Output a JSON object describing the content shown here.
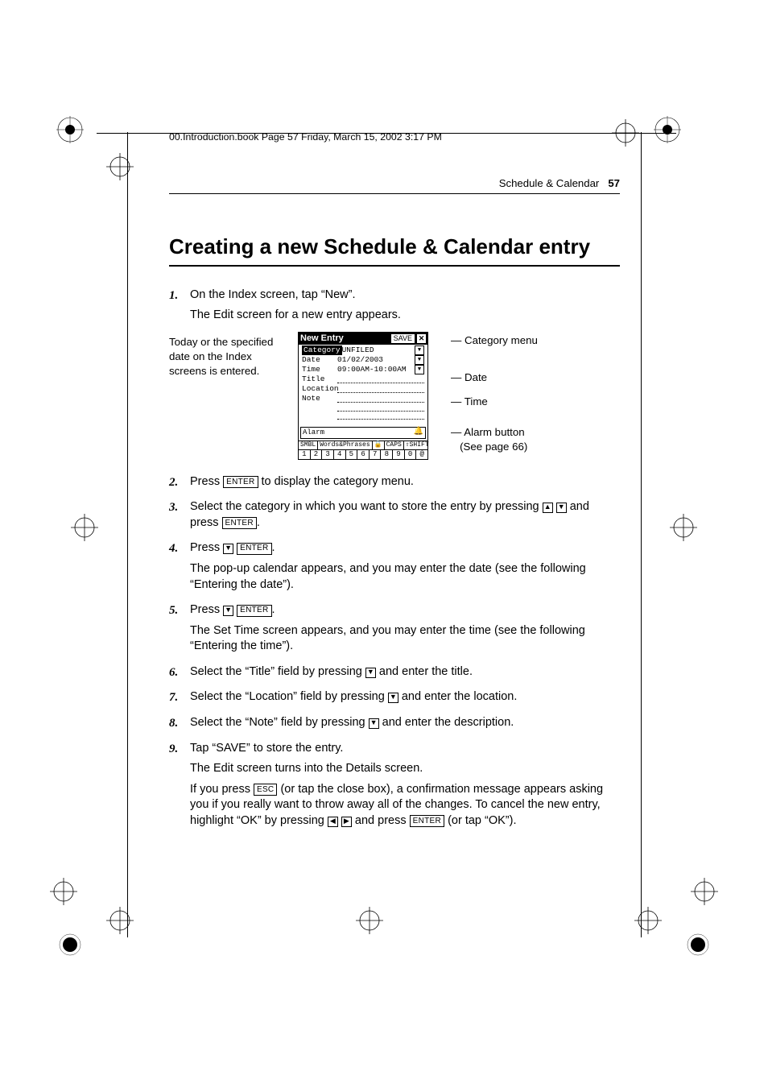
{
  "file_header": "00.Introduction.book  Page 57  Friday, March 15, 2002  3:17 PM",
  "running_head": {
    "section": "Schedule & Calendar",
    "page": "57"
  },
  "title": "Creating a new Schedule & Calendar entry",
  "sidecap_left": "Today or the specified date on the Index screens is entered.",
  "device": {
    "title": "New Entry",
    "save": "SAVE",
    "close": "✕",
    "rows": {
      "category_label": "Category",
      "category_value": "UNFILED",
      "date_label": "Date",
      "date_value": "01/02/2003",
      "time_label": "Time",
      "time_value": "09:00AM-10:00AM",
      "title_label": "Title",
      "location_label": "Location",
      "note_label": "Note",
      "alarm_label": "Alarm"
    },
    "softkeys": {
      "smbl": "SMBL",
      "words": "Words&Phrases",
      "lock": "🔒",
      "caps": "CAPS",
      "shift": "⇧SHIFT"
    },
    "numrow": [
      "1",
      "2",
      "3",
      "4",
      "5",
      "6",
      "7",
      "8",
      "9",
      "0",
      "@"
    ]
  },
  "callouts": {
    "category": "Category menu",
    "date": "Date",
    "time": "Time",
    "alarm1": "Alarm button",
    "alarm2": "(See page 66)"
  },
  "keys": {
    "enter": "ENTER",
    "esc": "ESC"
  },
  "steps": [
    {
      "n": "1.",
      "lines": [
        "On the Index screen, tap “New”.",
        "The Edit screen for a new entry appears."
      ],
      "has_figure": true
    },
    {
      "n": "2.",
      "html": "Press {ENTER} to display the category menu."
    },
    {
      "n": "3.",
      "html": "Select the category in which you want to store the entry by pressing {UP} {DOWN} and press {ENTER}."
    },
    {
      "n": "4.",
      "html": "Press {DOWN} {ENTER}.",
      "lines2": [
        "The pop-up calendar appears, and you may enter the date (see the following “Entering the date”)."
      ]
    },
    {
      "n": "5.",
      "html": "Press {DOWN} {ENTER}.",
      "lines2": [
        "The Set Time screen appears, and you may enter the time (see the following “Entering the time”)."
      ]
    },
    {
      "n": "6.",
      "html": "Select the “Title” field by pressing {DOWN} and enter the title."
    },
    {
      "n": "7.",
      "html": "Select the “Location” field by pressing {DOWN} and enter the location."
    },
    {
      "n": "8.",
      "html": "Select the “Note” field by pressing {DOWN} and enter the description."
    },
    {
      "n": "9.",
      "html": "Tap “SAVE” to store the entry.",
      "lines2": [
        "The Edit screen turns into the Details screen.",
        "If you press {ESC} (or tap the close box), a confirmation message appears asking you if you really want to throw away all of the changes. To cancel the new entry, highlight “OK” by pressing {LEFT} {RIGHT} and press {ENTER} (or tap “OK”)."
      ]
    }
  ]
}
